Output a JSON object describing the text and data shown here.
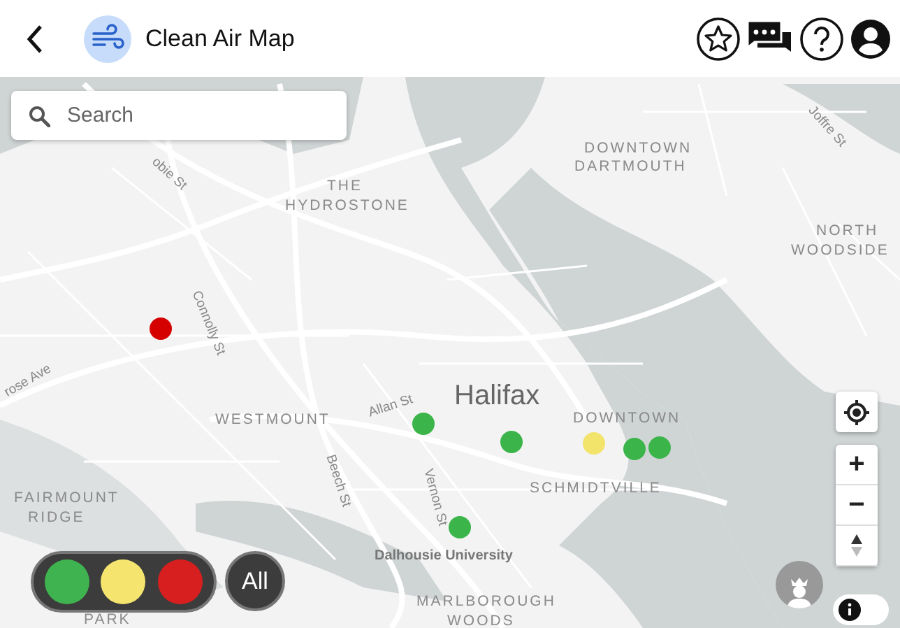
{
  "header": {
    "title": "Clean Air Map"
  },
  "search": {
    "placeholder": "Search"
  },
  "map_labels": [
    {
      "text": "DOWNTOWN",
      "kind": "district"
    },
    {
      "text": "DARTMOUTH",
      "kind": "district"
    },
    {
      "text": "THE",
      "kind": "district"
    },
    {
      "text": "HYDROSTONE",
      "kind": "district"
    },
    {
      "text": "NORTH",
      "kind": "district"
    },
    {
      "text": "WOODSIDE",
      "kind": "district"
    },
    {
      "text": "Halifax",
      "kind": "city"
    },
    {
      "text": "DOWNTOWN",
      "kind": "district"
    },
    {
      "text": "WESTMOUNT",
      "kind": "district"
    },
    {
      "text": "SCHMIDTVILLE",
      "kind": "district"
    },
    {
      "text": "FAIRMOUNT",
      "kind": "district"
    },
    {
      "text": "RIDGE",
      "kind": "district"
    },
    {
      "text": "MARLBOROUGH",
      "kind": "district"
    },
    {
      "text": "WOODS",
      "kind": "district"
    },
    {
      "text": "PARK",
      "kind": "district"
    },
    {
      "text": "Dalhousie University",
      "kind": "place"
    },
    {
      "text": "Allan St",
      "kind": "street"
    },
    {
      "text": "Beech St",
      "kind": "street"
    },
    {
      "text": "Vernon St",
      "kind": "street"
    },
    {
      "text": "Connolly St",
      "kind": "street"
    },
    {
      "text": "Joffre St",
      "kind": "street"
    },
    {
      "text": "obie St",
      "kind": "street"
    },
    {
      "text": "rose Ave",
      "kind": "street"
    }
  ],
  "markers": [
    {
      "color": "#d50000"
    },
    {
      "color": "#3bb54a"
    },
    {
      "color": "#3bb54a"
    },
    {
      "color": "#f2e36b"
    },
    {
      "color": "#3bb54a"
    },
    {
      "color": "#3bb54a"
    },
    {
      "color": "#3bb54a"
    }
  ],
  "filters": [
    {
      "color": "#3fb34f"
    },
    {
      "color": "#f5e56f"
    },
    {
      "color": "#d81f1f"
    }
  ],
  "all_button": {
    "label": "All"
  },
  "zoom": {
    "in": "+",
    "out": "−"
  }
}
